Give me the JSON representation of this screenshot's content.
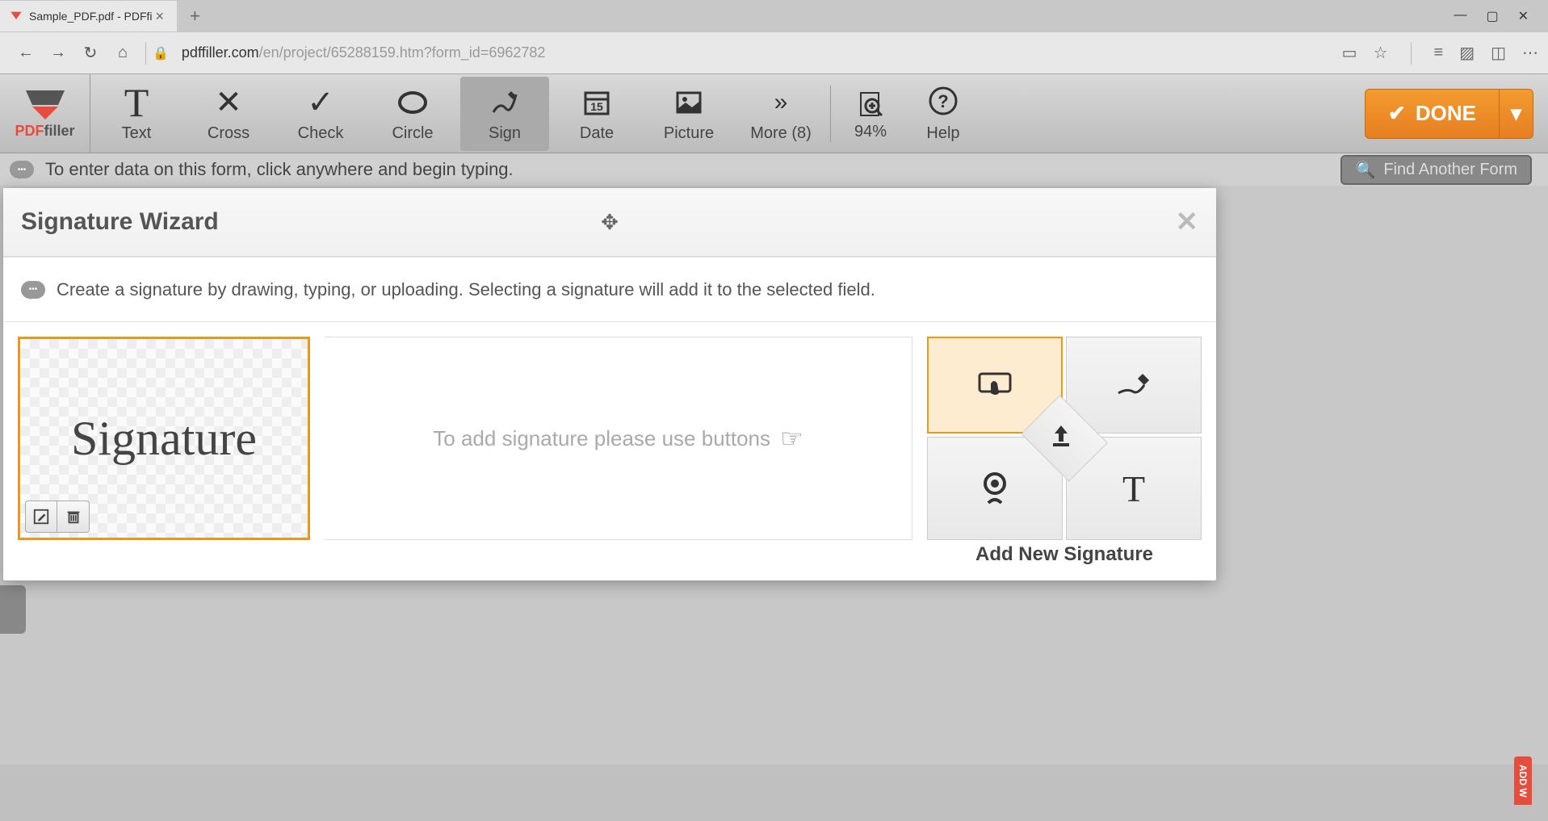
{
  "browser": {
    "tab_title": "Sample_PDF.pdf - PDFfi",
    "url_host": "pdffiller.com",
    "url_path": "/en/project/65288159.htm?form_id=6962782"
  },
  "logo": {
    "pdf": "PDF",
    "filler": "filler"
  },
  "toolbar": {
    "text": "Text",
    "cross": "Cross",
    "check": "Check",
    "circle": "Circle",
    "sign": "Sign",
    "date": "Date",
    "picture": "Picture",
    "more": "More (8)",
    "zoom": "94%",
    "help": "Help",
    "done": "DONE"
  },
  "hint": "To enter data on this form, click anywhere and begin typing.",
  "find_form": "Find Another Form",
  "modal": {
    "title": "Signature Wizard",
    "info": "Create a signature by drawing, typing, or uploading. Selecting a signature will add it to the selected field.",
    "placeholder": "To add signature please use buttons",
    "signature_sample": "Signature",
    "add_new": "Add New Signature"
  },
  "side": {
    "add_w": "ADD W"
  }
}
